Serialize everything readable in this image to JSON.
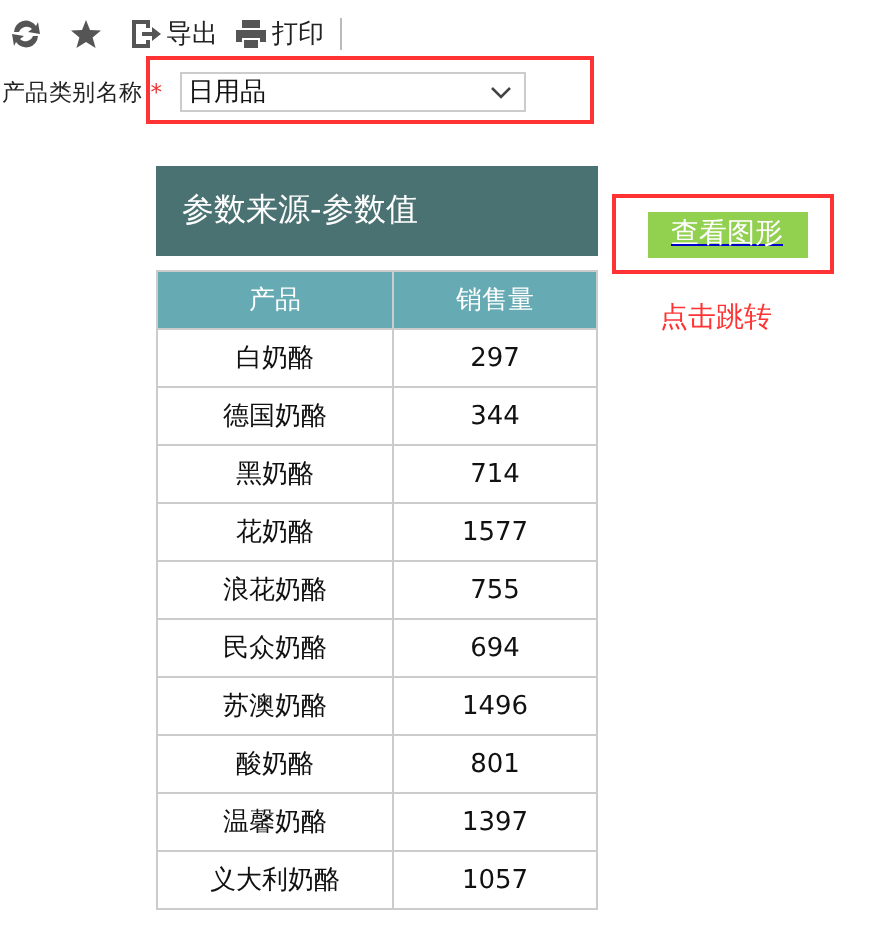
{
  "toolbar": {
    "items": [
      {
        "kind": "refresh"
      },
      {
        "kind": "star"
      },
      {
        "kind": "export",
        "label": "导出"
      },
      {
        "kind": "print",
        "label": "打印"
      }
    ]
  },
  "filter": {
    "label": "产品类别名称",
    "required_mark": "*",
    "value": "日用品"
  },
  "panel": {
    "title": "参数来源-参数值"
  },
  "table": {
    "columns": [
      "产品",
      "销售量"
    ],
    "rows": [
      [
        "白奶酪",
        "297"
      ],
      [
        "德国奶酪",
        "344"
      ],
      [
        "黑奶酪",
        "714"
      ],
      [
        "花奶酪",
        "1577"
      ],
      [
        "浪花奶酪",
        "755"
      ],
      [
        "民众奶酪",
        "694"
      ],
      [
        "苏澳奶酪",
        "1496"
      ],
      [
        "酸奶酪",
        "801"
      ],
      [
        "温馨奶酪",
        "1397"
      ],
      [
        "义大利奶酪",
        "1057"
      ]
    ]
  },
  "action": {
    "button": "查看图形",
    "note": "点击跳转"
  }
}
